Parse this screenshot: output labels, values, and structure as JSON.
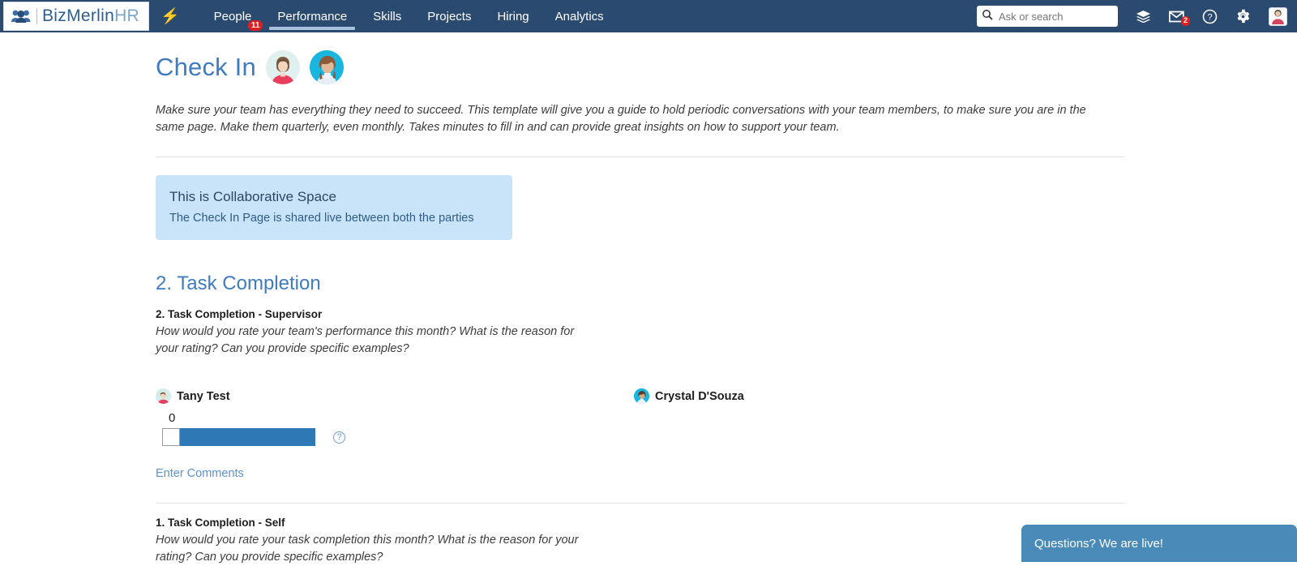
{
  "topnav": {
    "logo": {
      "name": "BizMerlin",
      "suffix": "HR",
      "icon": "people-icon"
    },
    "bolt_icon": "lightning-bolt-icon",
    "items": [
      {
        "label": "People",
        "active": false,
        "badge": "11"
      },
      {
        "label": "Performance",
        "active": true
      },
      {
        "label": "Skills",
        "active": false
      },
      {
        "label": "Projects",
        "active": false
      },
      {
        "label": "Hiring",
        "active": false
      },
      {
        "label": "Analytics",
        "active": false
      }
    ],
    "search": {
      "placeholder": "Ask or search",
      "value": "",
      "icon": "search-icon"
    },
    "icons": [
      {
        "name": "layers-icon"
      },
      {
        "name": "mail-icon",
        "badge": "2"
      },
      {
        "name": "help-circle-icon"
      },
      {
        "name": "gear-icon"
      },
      {
        "name": "user-avatar"
      }
    ]
  },
  "page": {
    "title": "Check In",
    "description": "Make sure your team has everything they need to succeed. This template will give you a guide to hold periodic conversations with your team members, to make sure you are in the same page. Make them quarterly, even monthly. Takes minutes to fill in and can provide great insights on how to support your team.",
    "callout": {
      "title": "This is Collaborative Space",
      "subtitle": "The Check In Page is shared live between both the parties"
    },
    "section": {
      "heading": "2. Task Completion",
      "supervisor": {
        "question_title": "2. Task Completion - Supervisor",
        "question_text": "How would you rate your team's performance this month? What is the reason for your rating? Can you provide specific examples?",
        "person_left": "Tany Test",
        "person_right": "Crystal D'Souza",
        "slider_value": "0",
        "help_icon": "help-circle-icon",
        "comments_link": "Enter Comments"
      },
      "self": {
        "question_title": "1. Task Completion - Self",
        "question_text": "How would you rate your task completion this month? What is the reason for your rating? Can you provide specific examples?"
      }
    }
  },
  "chat": {
    "label": "Questions? We are live!"
  },
  "colors": {
    "navbar": "#2b4a6f",
    "accent_blue": "#3f7cbf",
    "slider_fill": "#2e78b5",
    "callout_bg": "#c9e4f8",
    "chat_bg": "#4a8ab8",
    "badge_red": "#e02020"
  }
}
